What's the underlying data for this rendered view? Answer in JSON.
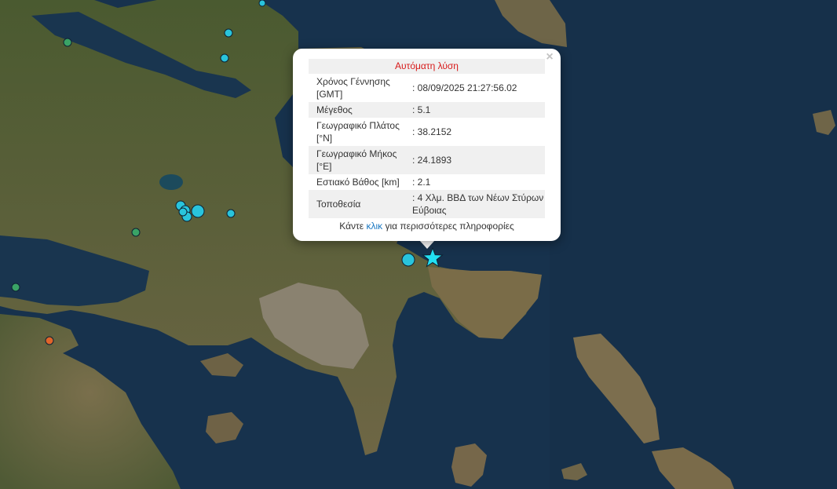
{
  "popup": {
    "title": "Αυτόματη λύση",
    "close_symbol": "×",
    "rows": [
      {
        "label": "Χρόνος Γέννησης [GMT]",
        "value": ": 08/09/2025 21:27:56.02"
      },
      {
        "label": "Μέγεθος",
        "value": ": 5.1"
      },
      {
        "label": "Γεωγραφικό Πλάτος [°N]",
        "value": ": 38.2152"
      },
      {
        "label": "Γεωγραφικό Μήκος [°E]",
        "value": ": 24.1893"
      },
      {
        "label": "Εστιακό Βάθος [km]",
        "value": ": 2.1"
      },
      {
        "label": "Τοποθεσία",
        "value": ": 4 Χλμ. ΒΒΔ των Νέων Στύρων Εύβοιας"
      }
    ],
    "footer_pre": "Κάντε",
    "footer_link": "κλικ",
    "footer_post": "για περισσότερες πληροφορίες"
  },
  "colors": {
    "sea": "#17324d",
    "land": "#6b6445",
    "quake_recent": "#29c4dc",
    "quake_older": "#3aa366",
    "quake_orange": "#e0642a",
    "main_event": "#22e0f2"
  },
  "markers": {
    "main_event_icon": "star-icon",
    "other_events_icon": "circle-icon"
  }
}
